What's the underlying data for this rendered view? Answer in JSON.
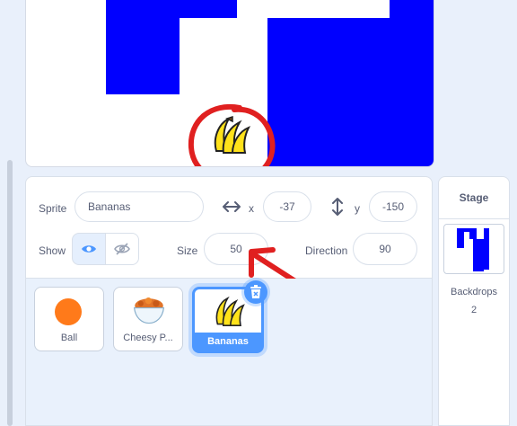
{
  "sprite_info": {
    "sprite_label": "Sprite",
    "sprite_name": "Bananas",
    "x_label": "x",
    "x_value": "-37",
    "y_label": "y",
    "y_value": "-150",
    "show_label": "Show",
    "size_label": "Size",
    "size_value": "50",
    "direction_label": "Direction",
    "direction_value": "90"
  },
  "sprites": [
    {
      "name": "Ball",
      "icon": "orange-ball-icon",
      "selected": false
    },
    {
      "name": "Cheesy P...",
      "icon": "cheesy-puffs-bowl-icon",
      "selected": false
    },
    {
      "name": "Bananas",
      "icon": "bananas-icon",
      "selected": true
    }
  ],
  "stage_pane": {
    "title": "Stage",
    "backdrops_label": "Backdrops",
    "backdrops_count": "2"
  },
  "colors": {
    "accent": "#4c97ff",
    "maze_blue": "#0000ff",
    "annotation_red": "#e02020"
  }
}
